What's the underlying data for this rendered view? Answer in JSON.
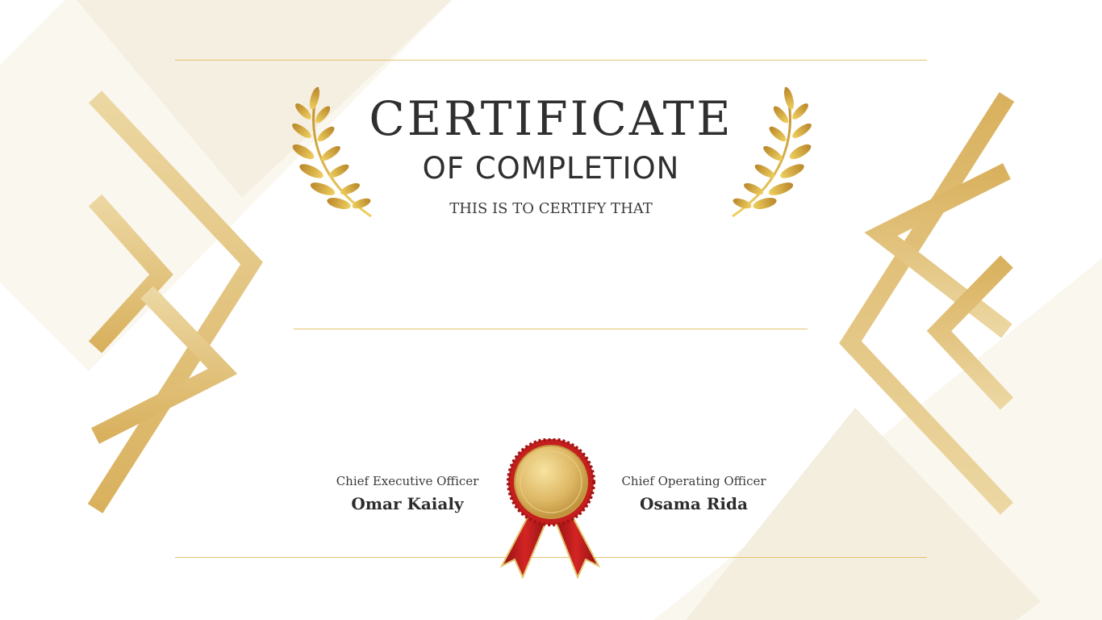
{
  "certificate": {
    "title": "CERTIFICATE",
    "subtitle": "OF COMPLETION",
    "certify_text": "THIS IS TO CERTIFY THAT"
  },
  "signatories": [
    {
      "role": "Chief Executive Officer",
      "name": "Omar Kaialy"
    },
    {
      "role": "Chief Operating Officer",
      "name": "Osama Rida"
    }
  ],
  "colors": {
    "gold": "#ddb764",
    "gold_light": "#e8d095",
    "ribbon_red": "#c41e1e",
    "text_dark": "#2f2f2f"
  },
  "icons": [
    "laurel-left-icon",
    "laurel-right-icon",
    "award-seal-icon"
  ]
}
